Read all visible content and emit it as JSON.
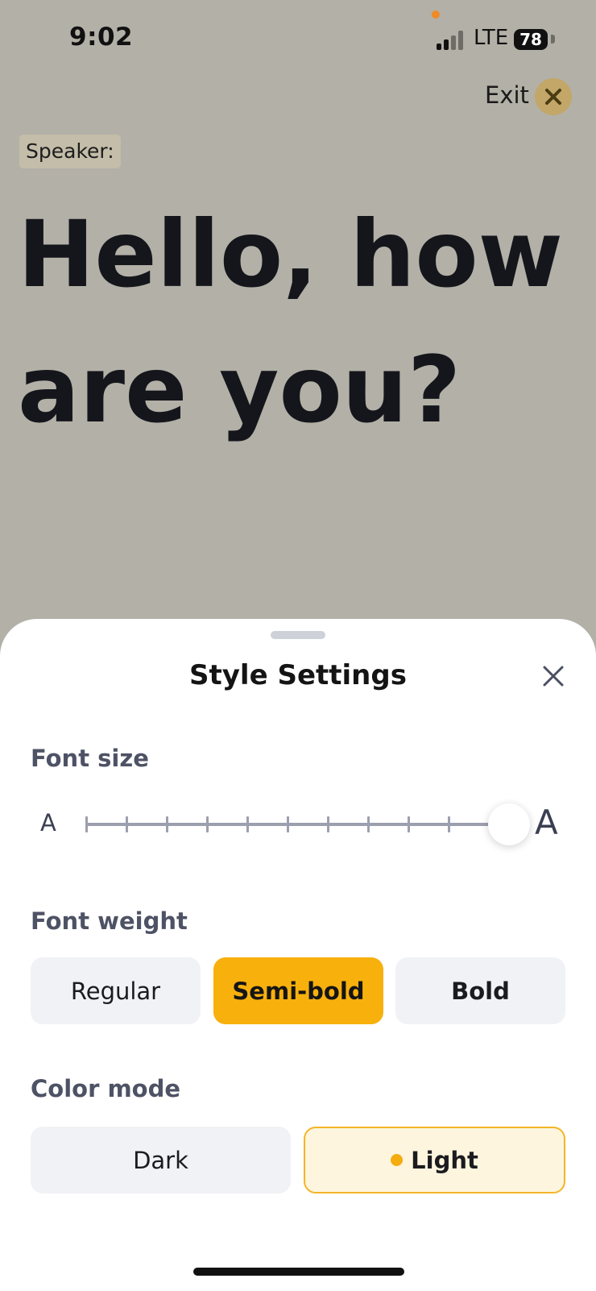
{
  "status_bar": {
    "time": "9:02",
    "network": "LTE",
    "battery": "78"
  },
  "header": {
    "exit_label": "Exit",
    "accent_color": "#c2a768"
  },
  "transcript": {
    "speaker_label": "Speaker:",
    "caption": "Hello, how are you?"
  },
  "style_settings": {
    "title": "Style Settings",
    "font_size": {
      "label": "Font size",
      "min_glyph": "A",
      "max_glyph": "A",
      "steps": 11,
      "selected_step": 11
    },
    "font_weight": {
      "label": "Font weight",
      "options": [
        "Regular",
        "Semi-bold",
        "Bold"
      ],
      "selected": "Semi-bold"
    },
    "color_mode": {
      "label": "Color mode",
      "options": [
        "Dark",
        "Light"
      ],
      "selected": "Light"
    },
    "accent_color": "#f8b00d"
  }
}
